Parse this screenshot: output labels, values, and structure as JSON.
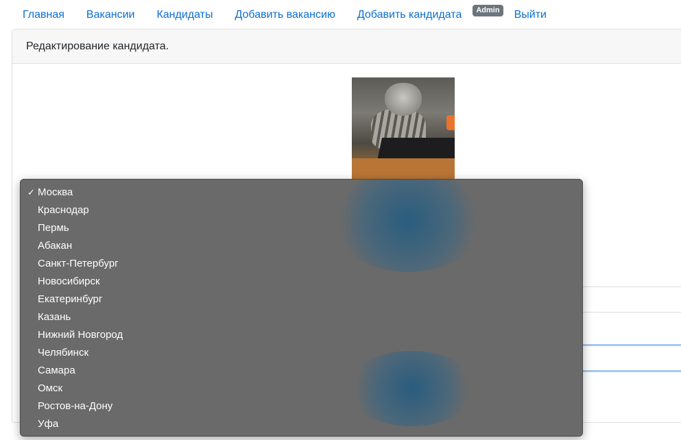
{
  "nav": {
    "items": [
      "Главная",
      "Вакансии",
      "Кандидаты",
      "Добавить вакансию",
      "Добавить кандидата"
    ],
    "badge": "Admin",
    "logout": "Выйти"
  },
  "card": {
    "header": "Редактирование кандидата."
  },
  "city_select": {
    "selected": "Москва",
    "options": [
      "Москва",
      "Краснодар",
      "Пермь",
      "Абакан",
      "Санкт-Петербург",
      "Новосибирск",
      "Екатеринбург",
      "Казань",
      "Нижний Новгород",
      "Челябинск",
      "Самара",
      "Омск",
      "Ростов-на-Дону",
      "Уфа"
    ],
    "check_glyph": "✓"
  },
  "colors": {
    "link": "#0a6ed1",
    "dropdown_bg": "#6a6a6a",
    "badge_bg": "#6c757d"
  }
}
